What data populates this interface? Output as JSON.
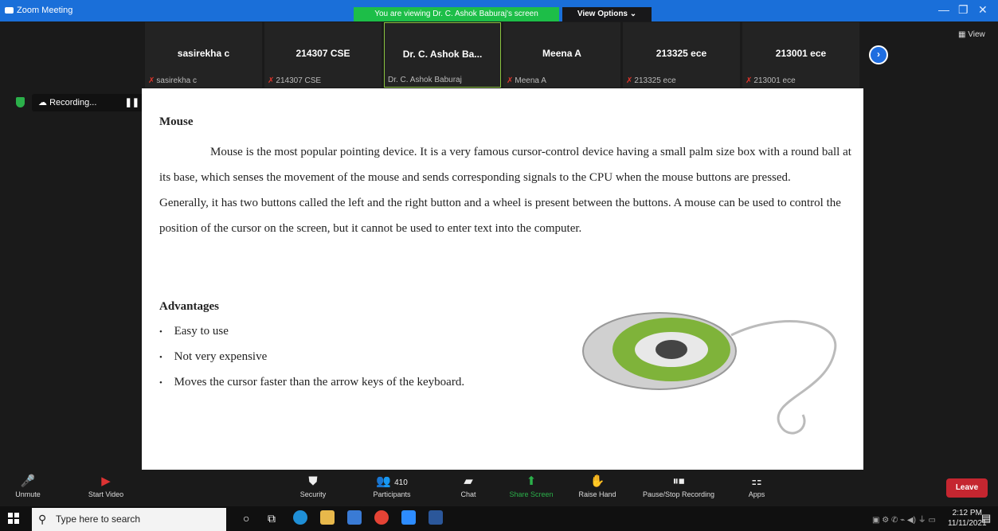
{
  "window": {
    "title": "Zoom Meeting",
    "viewing_banner": "You are viewing Dr. C. Ashok Baburaj's screen",
    "view_options": "View Options ⌄",
    "view_button": "View"
  },
  "participants": [
    {
      "name": "sasirekha c",
      "sub": "sasirekha c",
      "muted": true
    },
    {
      "name": "214307 CSE",
      "sub": "214307 CSE",
      "muted": true
    },
    {
      "name": "Dr. C. Ashok Ba...",
      "sub": "Dr. C. Ashok Baburaj",
      "muted": false
    },
    {
      "name": "Meena A",
      "sub": "Meena A",
      "muted": true
    },
    {
      "name": "213325 ece",
      "sub": "213325 ece",
      "muted": true
    },
    {
      "name": "213001 ece",
      "sub": "213001 ece",
      "muted": true
    }
  ],
  "recording": {
    "label": "Recording..."
  },
  "shared": {
    "heading": "Mouse",
    "paragraph1": "Mouse is the most popular pointing device. It is a very famous cursor-control device having a small palm size box with a round ball at its base, which senses the movement of the mouse and sends corresponding signals to the CPU when the mouse buttons are pressed.",
    "paragraph2": "Generally, it has two buttons called the left and the right button and a wheel is present between the buttons. A mouse can be used to control the position of the cursor on the screen, but it cannot be used to enter text into the computer.",
    "advantages_heading": "Advantages",
    "advantages": [
      "Easy to use",
      "Not very expensive",
      "Moves the cursor faster than the arrow keys of the keyboard."
    ]
  },
  "toolbar": {
    "unmute": "Unmute",
    "start_video": "Start Video",
    "security": "Security",
    "participants_label": "Participants",
    "participants_count": "410",
    "chat": "Chat",
    "share_screen": "Share Screen",
    "raise_hand": "Raise Hand",
    "pause_stop": "Pause/Stop Recording",
    "apps": "Apps",
    "leave": "Leave"
  },
  "taskbar": {
    "search_placeholder": "Type here to search",
    "time": "2:12 PM",
    "date": "11/11/2021"
  }
}
